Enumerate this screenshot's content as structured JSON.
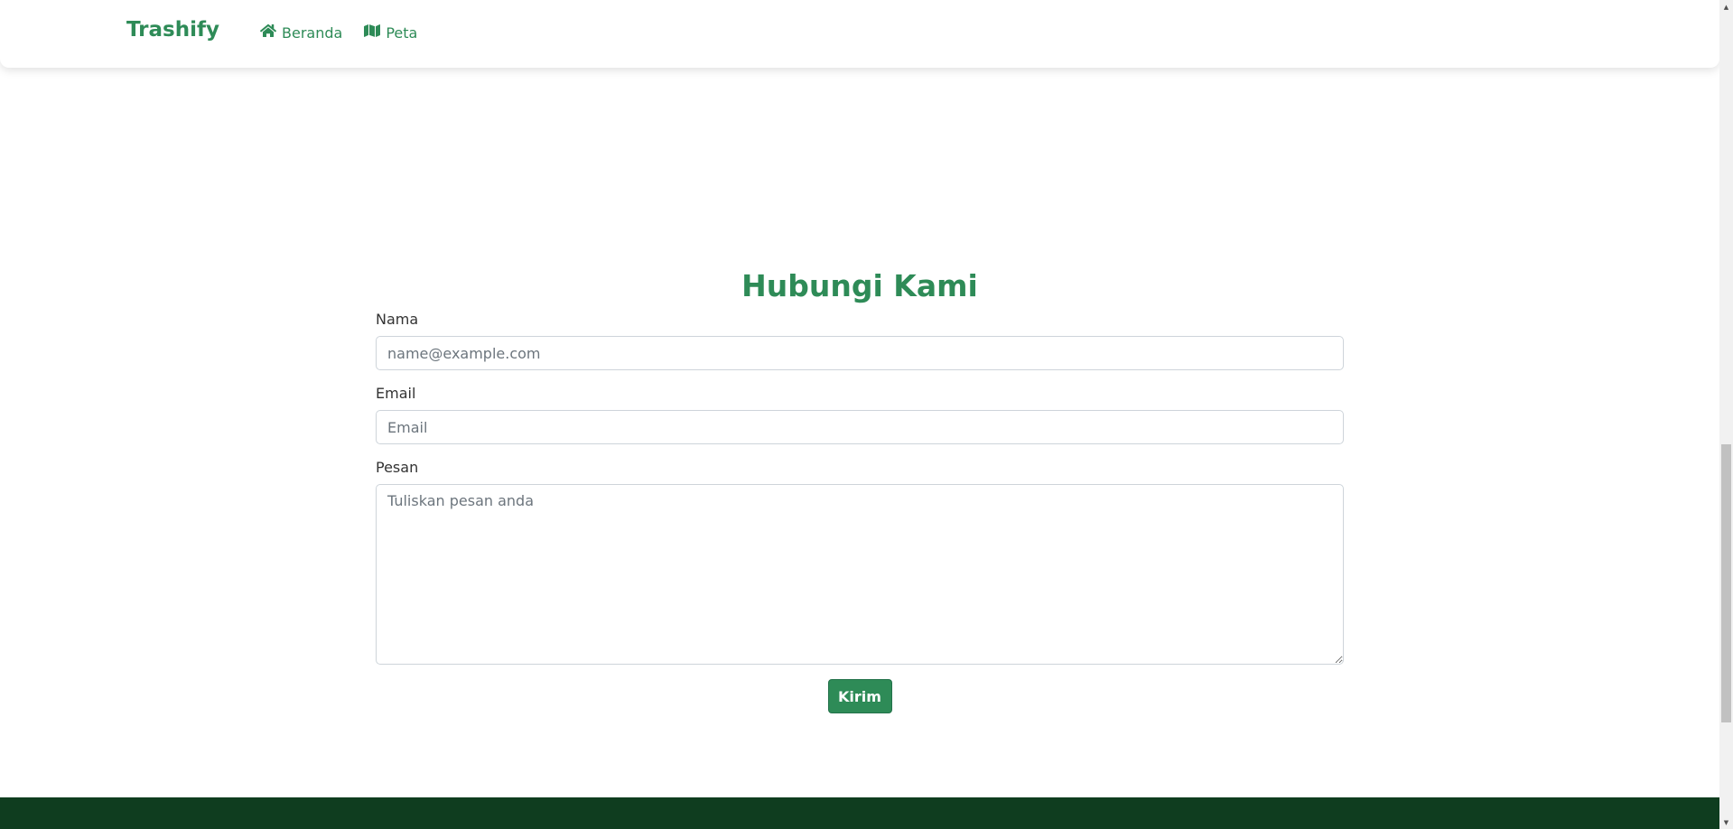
{
  "navbar": {
    "brand": "Trashify",
    "links": [
      {
        "label": "Beranda",
        "icon": "home-icon"
      },
      {
        "label": "Peta",
        "icon": "map-icon"
      }
    ]
  },
  "contact": {
    "title": "Hubungi Kami",
    "name_label": "Nama",
    "name_placeholder": "name@example.com",
    "email_label": "Email",
    "email_placeholder": "Email",
    "message_label": "Pesan",
    "message_placeholder": "Tuliskan pesan anda",
    "submit_label": "Kirim"
  },
  "colors": {
    "brand": "#2e8b57",
    "footer": "#0f3d1f"
  }
}
